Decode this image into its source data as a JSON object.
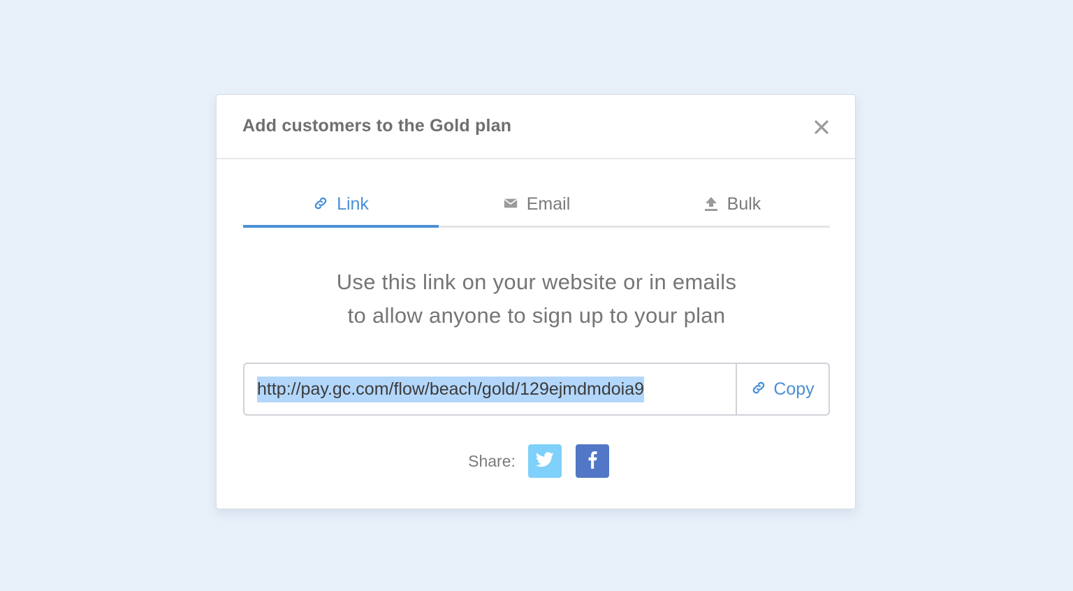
{
  "modal": {
    "title": "Add customers to the Gold plan",
    "close_icon": "close-icon"
  },
  "tabs": [
    {
      "label": "Link",
      "icon": "link-icon",
      "active": true
    },
    {
      "label": "Email",
      "icon": "envelope-icon",
      "active": false
    },
    {
      "label": "Bulk",
      "icon": "upload-icon",
      "active": false
    }
  ],
  "description": {
    "line1": "Use this link on your website or in emails",
    "line2": "to allow anyone to sign up to your plan"
  },
  "link": {
    "value": "http://pay.gc.com/flow/beach/gold/129ejmdmdoia9",
    "copy_label": "Copy"
  },
  "share": {
    "label": "Share:",
    "buttons": [
      {
        "name": "twitter",
        "icon": "twitter-icon"
      },
      {
        "name": "facebook",
        "icon": "facebook-icon"
      }
    ]
  },
  "colors": {
    "accent": "#4a90d6",
    "background": "#e8f0fa",
    "twitter": "#7fd0fa",
    "facebook": "#5277c6",
    "selection": "#b3d7fb"
  }
}
